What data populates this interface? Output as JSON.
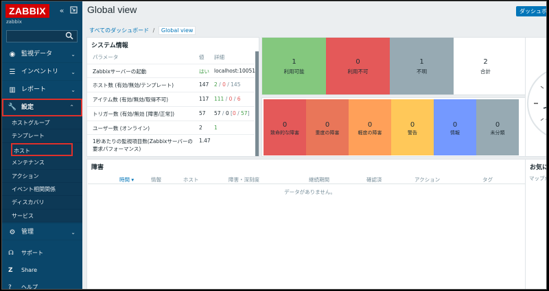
{
  "app": {
    "logo": "ZABBIX",
    "server_name": "zabbix"
  },
  "search": {
    "placeholder": ""
  },
  "sidebar": {
    "items": [
      {
        "label": "監視データ",
        "icon": "eye-icon"
      },
      {
        "label": "インベントリ",
        "icon": "list-icon"
      },
      {
        "label": "レポート",
        "icon": "bar-chart-icon"
      },
      {
        "label": "設定",
        "icon": "wrench-icon"
      }
    ],
    "config_sub": [
      "ホストグループ",
      "テンプレート",
      "ホスト",
      "メンテナンス",
      "アクション",
      "イベント相関関係",
      "ディスカバリ",
      "サービス"
    ],
    "admin": {
      "label": "管理",
      "icon": "gear-icon"
    },
    "support": {
      "label": "サポート",
      "icon": "headset-icon"
    },
    "share": {
      "label": "Share",
      "icon": "share-icon"
    },
    "help": {
      "label": "ヘルプ",
      "icon": "help-icon"
    }
  },
  "header": {
    "title": "Global view",
    "dashboard_button": "ダッシュボード"
  },
  "breadcrumb": {
    "parent": "すべてのダッシュボード",
    "separator": "/",
    "current": "Global view"
  },
  "system_info": {
    "title": "システム情報",
    "headers": [
      "パラメータ",
      "値",
      "詳細"
    ],
    "rows": [
      {
        "param": "Zabbixサーバーの起動",
        "value": "はい",
        "detail": "localhost:10051"
      },
      {
        "param": "ホスト数 (有効/無効/テンプレート)",
        "value": "147",
        "d1": "2",
        "d2": "0",
        "d3": "145"
      },
      {
        "param": "アイテム数 (有効/無効/取得不可)",
        "value": "117",
        "d1": "111",
        "d2": "0",
        "d3": "6"
      },
      {
        "param": "トリガー数 (有効/無効 [障害/正常])",
        "value": "57",
        "d1": "57",
        "d2": "0",
        "d3": "0",
        "d4": "57"
      },
      {
        "param": "ユーザー数 (オンライン)",
        "value": "2",
        "detail": "1"
      },
      {
        "param": "1秒あたりの監視項目数(Zabbixサーバーの要求パフォーマンス)",
        "value": "1.47",
        "detail": ""
      }
    ]
  },
  "host_availability": [
    {
      "count": "1",
      "label": "利用可能",
      "color": "#84c87e"
    },
    {
      "count": "0",
      "label": "利用不可",
      "color": "#e45959"
    },
    {
      "count": "1",
      "label": "不明",
      "color": "#97aab3"
    },
    {
      "count": "2",
      "label": "合計",
      "color": "#ffffff"
    }
  ],
  "severity": [
    {
      "count": "0",
      "label": "致命的な障害",
      "color": "#e45959"
    },
    {
      "count": "0",
      "label": "重度の障害",
      "color": "#e97659"
    },
    {
      "count": "0",
      "label": "軽度の障害",
      "color": "#ffa059"
    },
    {
      "count": "0",
      "label": "警告",
      "color": "#ffc859"
    },
    {
      "count": "0",
      "label": "情報",
      "color": "#7499ff"
    },
    {
      "count": "0",
      "label": "未分類",
      "color": "#97aab3"
    }
  ],
  "problems": {
    "title": "障害",
    "columns": [
      "時間 ▾",
      "情報",
      "ホスト",
      "障害・深刻度",
      "継続期間",
      "確認済",
      "アクション",
      "タグ"
    ],
    "empty_text": "データがありません。"
  },
  "favorites": {
    "title": "お気に入りのマップ",
    "subtitle": "マップが追加されていません。"
  }
}
